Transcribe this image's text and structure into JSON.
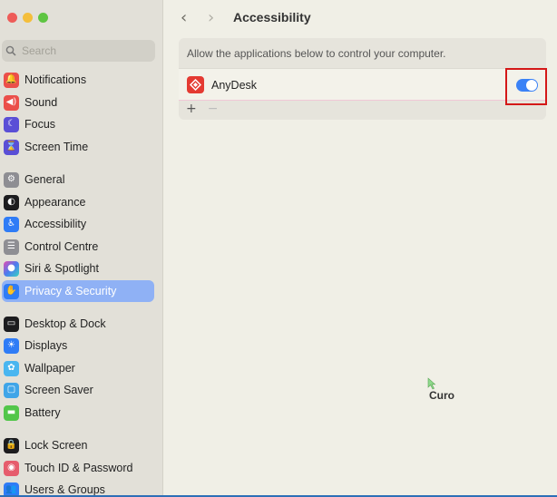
{
  "sidebar": {
    "search_placeholder": "Search",
    "items": [
      {
        "label": "Notifications",
        "color": "#eb4f4a",
        "icon": "bell-icon"
      },
      {
        "label": "Sound",
        "color": "#eb4f4a",
        "icon": "speaker-icon"
      },
      {
        "label": "Focus",
        "color": "#5a4fd6",
        "icon": "moon-icon"
      },
      {
        "label": "Screen Time",
        "color": "#5a4fd6",
        "icon": "hourglass-icon"
      },
      {
        "label": "General",
        "color": "#8e8e93",
        "icon": "gear-icon"
      },
      {
        "label": "Appearance",
        "color": "#1c1c1e",
        "icon": "appearance-icon"
      },
      {
        "label": "Accessibility",
        "color": "#2f7cf6",
        "icon": "accessibility-icon"
      },
      {
        "label": "Control Centre",
        "color": "#8e8e93",
        "icon": "control-centre-icon"
      },
      {
        "label": "Siri & Spotlight",
        "color": "#7b3fe4",
        "icon": "siri-icon"
      },
      {
        "label": "Privacy & Security",
        "color": "#2f7cf6",
        "icon": "hand-icon",
        "selected": true
      },
      {
        "label": "Desktop & Dock",
        "color": "#1c1c1e",
        "icon": "dock-icon"
      },
      {
        "label": "Displays",
        "color": "#2f7cf6",
        "icon": "sun-icon"
      },
      {
        "label": "Wallpaper",
        "color": "#49b6f0",
        "icon": "flower-icon"
      },
      {
        "label": "Screen Saver",
        "color": "#3fa5e8",
        "icon": "screensaver-icon"
      },
      {
        "label": "Battery",
        "color": "#52c64a",
        "icon": "battery-icon"
      },
      {
        "label": "Lock Screen",
        "color": "#1c1c1e",
        "icon": "lock-icon"
      },
      {
        "label": "Touch ID & Password",
        "color": "#e65c6c",
        "icon": "fingerprint-icon"
      },
      {
        "label": "Users & Groups",
        "color": "#2f7cf6",
        "icon": "users-icon"
      }
    ]
  },
  "header": {
    "title": "Accessibility"
  },
  "panel": {
    "description": "Allow the applications below to control your computer.",
    "apps": [
      {
        "name": "AnyDesk",
        "enabled": true
      }
    ],
    "add_label": "+",
    "remove_label": "−"
  },
  "cursor_label": "Curo",
  "colors": {
    "accent": "#3b82f6",
    "selection": "#8fb1f5",
    "highlight": "#d41818"
  }
}
